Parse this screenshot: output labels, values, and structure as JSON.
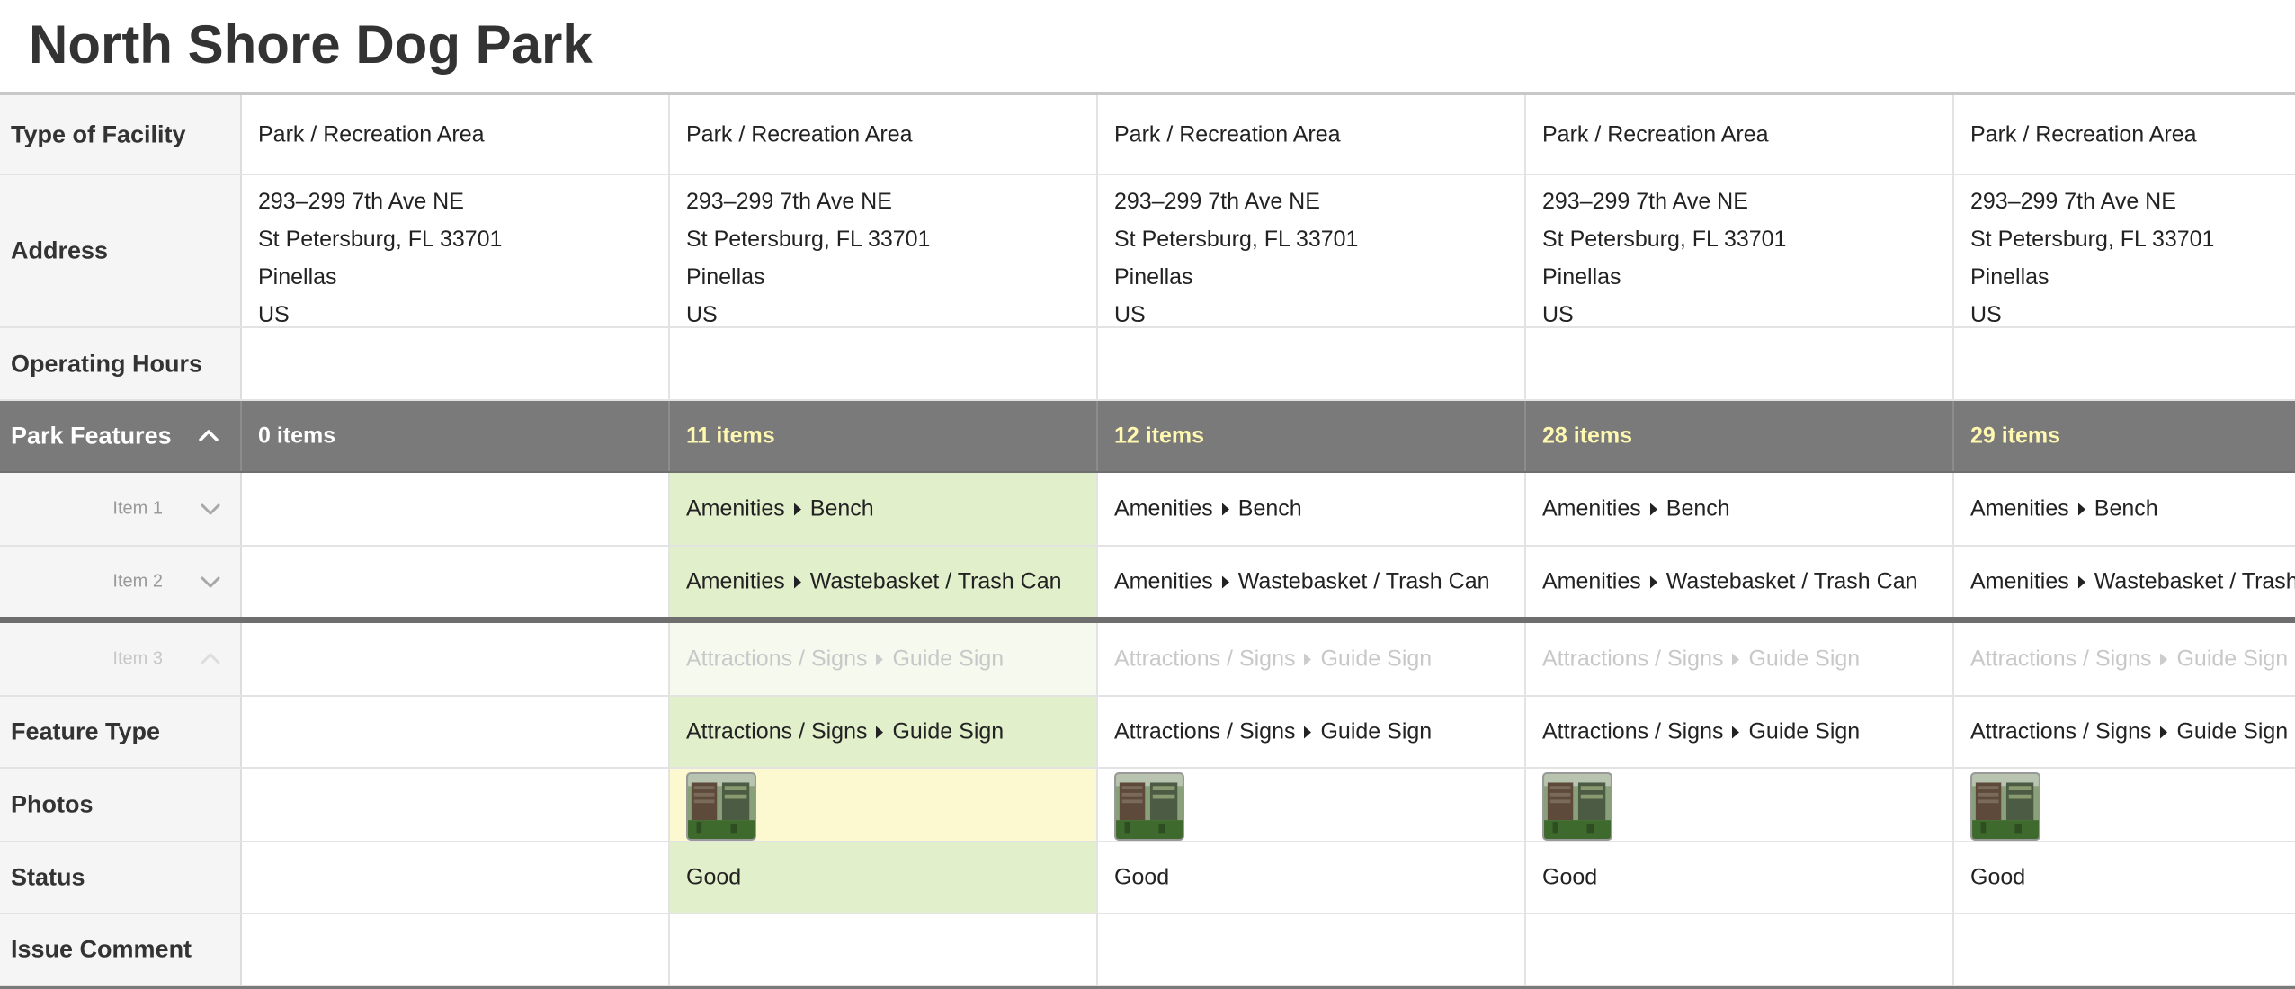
{
  "page": {
    "title": "North Shore Dog Park"
  },
  "rows": {
    "type_of_facility": {
      "label": "Type of Facility",
      "values": [
        "Park / Recreation Area",
        "Park / Recreation Area",
        "Park / Recreation Area",
        "Park / Recreation Area",
        "Park / Recreation Area"
      ]
    },
    "address": {
      "label": "Address",
      "values": [
        [
          "293–299 7th Ave NE",
          "St Petersburg, FL 33701",
          "Pinellas",
          "US"
        ],
        [
          "293–299 7th Ave NE",
          "St Petersburg, FL 33701",
          "Pinellas",
          "US"
        ],
        [
          "293–299 7th Ave NE",
          "St Petersburg, FL 33701",
          "Pinellas",
          "US"
        ],
        [
          "293–299 7th Ave NE",
          "St Petersburg, FL 33701",
          "Pinellas",
          "US"
        ],
        [
          "293–299 7th Ave NE",
          "St Petersburg, FL 33701",
          "Pinellas",
          "US"
        ]
      ]
    },
    "operating_hours": {
      "label": "Operating Hours",
      "values": [
        "",
        "",
        "",
        "",
        ""
      ]
    },
    "park_features": {
      "label": "Park Features",
      "counts": [
        "0 items",
        "11 items",
        "12 items",
        "28 items",
        "29 items"
      ],
      "count_colors": [
        "#ffffff",
        "#fff8b0",
        "#fff8b0",
        "#fff8b0",
        "#fff8b0"
      ],
      "toggle_icon": "chevron-up-icon"
    },
    "item1": {
      "label": "Item 1",
      "values": [
        null,
        [
          "Amenities",
          "Bench"
        ],
        [
          "Amenities",
          "Bench"
        ],
        [
          "Amenities",
          "Bench"
        ],
        [
          "Amenities",
          "Bench"
        ]
      ]
    },
    "item2": {
      "label": "Item 2",
      "values": [
        null,
        [
          "Amenities",
          "Wastebasket / Trash Can"
        ],
        [
          "Amenities",
          "Wastebasket / Trash Can"
        ],
        [
          "Amenities",
          "Wastebasket / Trash Can"
        ],
        [
          "Amenities",
          "Wastebasket / Trash"
        ]
      ]
    },
    "item3": {
      "label": "Item 3",
      "values": [
        null,
        [
          "Attractions / Signs",
          "Guide Sign"
        ],
        [
          "Attractions / Signs",
          "Guide Sign"
        ],
        [
          "Attractions / Signs",
          "Guide Sign"
        ],
        [
          "Attractions / Signs",
          "Guide Sign"
        ]
      ]
    },
    "feature_type": {
      "label": "Feature Type",
      "values": [
        null,
        [
          "Attractions / Signs",
          "Guide Sign"
        ],
        [
          "Attractions / Signs",
          "Guide Sign"
        ],
        [
          "Attractions / Signs",
          "Guide Sign"
        ],
        [
          "Attractions / Signs",
          "Guide Sign"
        ]
      ]
    },
    "photos": {
      "label": "Photos",
      "has_photo": [
        false,
        true,
        true,
        true,
        true
      ]
    },
    "status": {
      "label": "Status",
      "values": [
        "",
        "Good",
        "Good",
        "Good",
        "Good"
      ]
    },
    "issue_comment": {
      "label": "Issue Comment",
      "values": [
        "",
        "",
        "",
        "",
        ""
      ]
    }
  },
  "colors": {
    "changed_highlight": "#e2efcb",
    "photo_highlight": "#fcf9d0",
    "group_header_bg": "#7a7a7a"
  }
}
